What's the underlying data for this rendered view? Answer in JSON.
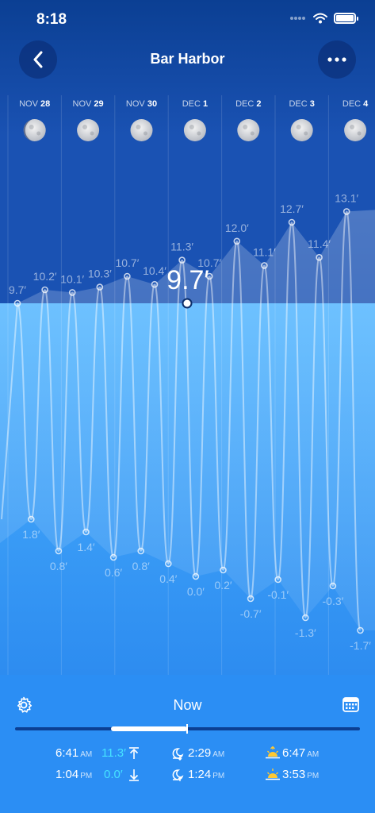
{
  "status": {
    "time": "8:18"
  },
  "header": {
    "title": "Bar Harbor"
  },
  "days": [
    {
      "month": "NOV",
      "day": "28"
    },
    {
      "month": "NOV",
      "day": "29"
    },
    {
      "month": "NOV",
      "day": "30"
    },
    {
      "month": "DEC",
      "day": "1"
    },
    {
      "month": "DEC",
      "day": "2"
    },
    {
      "month": "DEC",
      "day": "3"
    },
    {
      "month": "DEC",
      "day": "4"
    }
  ],
  "current_height": "9.7′",
  "chart_data": {
    "type": "line",
    "x_label_points": [
      {
        "label": "9.7′",
        "kind": "high"
      },
      {
        "label": "1.8′",
        "kind": "low"
      },
      {
        "label": "10.2′",
        "kind": "high"
      },
      {
        "label": "0.8′",
        "kind": "low"
      },
      {
        "label": "10.1′",
        "kind": "high"
      },
      {
        "label": "1.4′",
        "kind": "low"
      },
      {
        "label": "10.3′",
        "kind": "high"
      },
      {
        "label": "0.6′",
        "kind": "low"
      },
      {
        "label": "10.7′",
        "kind": "high"
      },
      {
        "label": "0.8′",
        "kind": "low"
      },
      {
        "label": "10.4′",
        "kind": "high"
      },
      {
        "label": "0.4′",
        "kind": "low"
      },
      {
        "label": "11.3′",
        "kind": "high"
      },
      {
        "label": "0.0′",
        "kind": "low"
      },
      {
        "label": "10.7′",
        "kind": "high"
      },
      {
        "label": "0.2′",
        "kind": "low"
      },
      {
        "label": "12.0′",
        "kind": "high"
      },
      {
        "label": "-0.7′",
        "kind": "low"
      },
      {
        "label": "11.1′",
        "kind": "high"
      },
      {
        "label": "-0.1′",
        "kind": "low"
      },
      {
        "label": "12.7′",
        "kind": "high"
      },
      {
        "label": "-1.3′",
        "kind": "low"
      },
      {
        "label": "11.4′",
        "kind": "high"
      },
      {
        "label": "-0.3′",
        "kind": "low"
      },
      {
        "label": "13.1′",
        "kind": "high"
      },
      {
        "label": "-1.7′",
        "kind": "low"
      }
    ],
    "values": [
      9.7,
      1.8,
      10.2,
      0.8,
      10.1,
      1.4,
      10.3,
      0.6,
      10.7,
      0.8,
      10.4,
      0.4,
      11.3,
      0.0,
      10.7,
      0.2,
      12.0,
      -0.7,
      11.1,
      -0.1,
      12.7,
      -1.3,
      11.4,
      -0.3,
      13.1,
      -1.7
    ],
    "current_value": 9.7
  },
  "controls": {
    "now_label": "Now",
    "tides": [
      {
        "time": "6:41",
        "ampm": "AM",
        "height": "11.3′",
        "direction": "high-tide-icon"
      },
      {
        "time": "1:04",
        "ampm": "PM",
        "height": "0.0′",
        "direction": "low-tide-icon"
      }
    ],
    "moon": [
      {
        "time": "2:29",
        "ampm": "AM",
        "event": "moonset-icon"
      },
      {
        "time": "1:24",
        "ampm": "PM",
        "event": "moonrise-icon"
      }
    ],
    "sun": [
      {
        "time": "6:47",
        "ampm": "AM",
        "event": "sunrise-icon"
      },
      {
        "time": "3:53",
        "ampm": "PM",
        "event": "sunset-icon"
      }
    ]
  },
  "colors": {
    "sky_top": "#0b3f93",
    "sky_bottom": "#1f5fc4",
    "water": "#4cb3ff",
    "accent": "#46e3ff"
  }
}
